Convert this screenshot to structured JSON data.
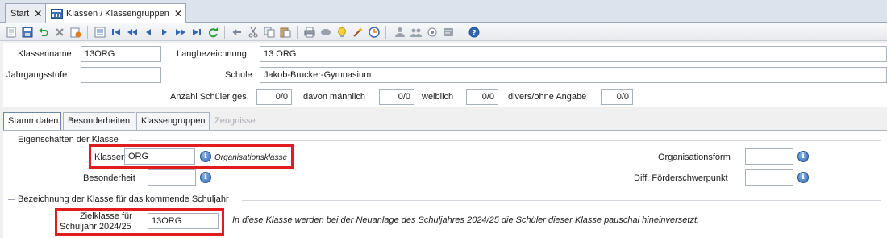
{
  "tabs": [
    {
      "label": "Start",
      "close": "✕"
    },
    {
      "label": "Klassen / Klassengruppen",
      "close": "✕"
    }
  ],
  "toolbar_icons": [
    "new-icon",
    "save-icon",
    "undo-icon",
    "delete-icon",
    "reset-icon",
    "list-icon",
    "first-icon",
    "prev-fast-icon",
    "prev-icon",
    "next-icon",
    "next-fast-icon",
    "last-icon",
    "refresh-icon",
    "back-arrow-icon",
    "cut-icon",
    "copy-icon",
    "paste-icon",
    "print-icon",
    "preview-icon",
    "bulb-icon",
    "wizard-icon",
    "clock-icon",
    "users-icon",
    "user-group-icon",
    "settings-icon",
    "note-icon",
    "help-icon"
  ],
  "header": {
    "klassenname_label": "Klassenname",
    "klassenname_value": "13ORG",
    "langbezeichnung_label": "Langbezeichnung",
    "langbezeichnung_value": "13 ORG",
    "jahrgangsstufe_label": "Jahrgangsstufe",
    "jahrgangsstufe_value": "",
    "schule_label": "Schule",
    "schule_value": "Jakob-Brucker-Gymnasium",
    "anzahl_label": "Anzahl Schüler ges.",
    "anzahl_value": "0/0",
    "maennlich_label": "davon männlich",
    "maennlich_value": "0/0",
    "weiblich_label": "weiblich",
    "weiblich_value": "0/0",
    "divers_label": "divers/ohne Angabe",
    "divers_value": "0/0"
  },
  "sub_tabs": [
    "Stammdaten",
    "Besonderheiten",
    "Klassengruppen",
    "Zeugnisse"
  ],
  "eigenschaften": {
    "title": "Eigenschaften der Klasse",
    "klassenart_label": "Klassenart",
    "klassenart_value": "ORG",
    "klassenart_hint": "Organisationsklasse",
    "besonderheit_label": "Besonderheit",
    "besonderheit_value": "",
    "organisationsform_label": "Organisationsform",
    "organisationsform_value": "",
    "foerder_label": "Diff. Förderschwerpunkt",
    "foerder_value": ""
  },
  "kommend": {
    "title": "Bezeichnung der Klasse für das kommende Schuljahr",
    "ziel_label_1": "Zielklasse für",
    "ziel_label_2": "Schuljahr 2024/25",
    "ziel_value": "13ORG",
    "hint": "In diese Klasse werden bei der Neuanlage des Schuljahres 2024/25 die Schüler dieser Klasse pauschal hineinversetzt."
  },
  "colors": {
    "highlight": "#e01c1c",
    "info": "#2f67b4"
  }
}
